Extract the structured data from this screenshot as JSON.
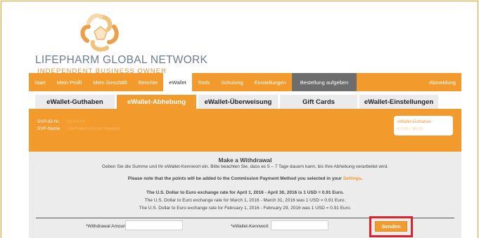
{
  "brand": {
    "name": "LIFEPHARM GLOBAL NETWORK",
    "tagline": "INDEPENDENT BUSINESS OWNER",
    "logo_icon": "flower-knot-logo"
  },
  "topnav": {
    "items": [
      "Start",
      "Mein Profil",
      "Mein Geschäft",
      "Berichte",
      "eWallet",
      "Tools",
      "Schulung",
      "Einstellungen",
      "Bestellung aufgeben"
    ],
    "active": "eWallet",
    "logout": "Abmeldung"
  },
  "subtabs": [
    "eWallet-Guthaben",
    "eWallet-Abhebung",
    "eWallet-Überweisung",
    "Gift Cards",
    "eWallet-Einstellungen"
  ],
  "subtab_active": "eWallet-Abhebung",
  "info": {
    "svp_id_label": "SVP-ID-Nr.",
    "svp_id_value": "XXXXXX",
    "svp_name_label": "SVP-Name",
    "svp_name_value": "LifePharm Global Network",
    "box_link": "eWallet-Guthaben",
    "box_value": "€ 0,00 / $0,00"
  },
  "content": {
    "title": "Make a Withdrawal",
    "instruction": "Geben Sie die Summe und Ihr eWallet-Kennwort ein. Bitte beachten Sie, dass es 5 – 7 Tage dauern kann, bis Ihre Abhebung verarbeitet wird.",
    "note_prefix": "Please note that the points will be added to the Commission Payment Method you selected in your ",
    "note_link": "Settings",
    "note_suffix": ".",
    "rate1": "The U.S. Dollar to Euro exchange rate for April 1, 2016 - April 30, 2016 is 1 USD = 0.91 Euro.",
    "rate2": "The U.S. Dollar to Euro exchange rate for March 1, 2016 - March 31, 2016 was 1 USD = 0.91 Euro.",
    "rate3": "The U.S. Dollar to Euro exchange rate for February 1, 2016 - February 29, 2016 was 1 USD = 0.91 Euro."
  },
  "form": {
    "amount_label": "*Withdrawal Amount",
    "amount_value": "",
    "password_label": "*eWallet-Kennwort",
    "password_value": "",
    "submit_label": "Senden"
  },
  "colors": {
    "accent": "#f39a2c",
    "highlight": "#e0202b",
    "panel": "#ececec",
    "nav_dark": "#6d6d6d"
  }
}
